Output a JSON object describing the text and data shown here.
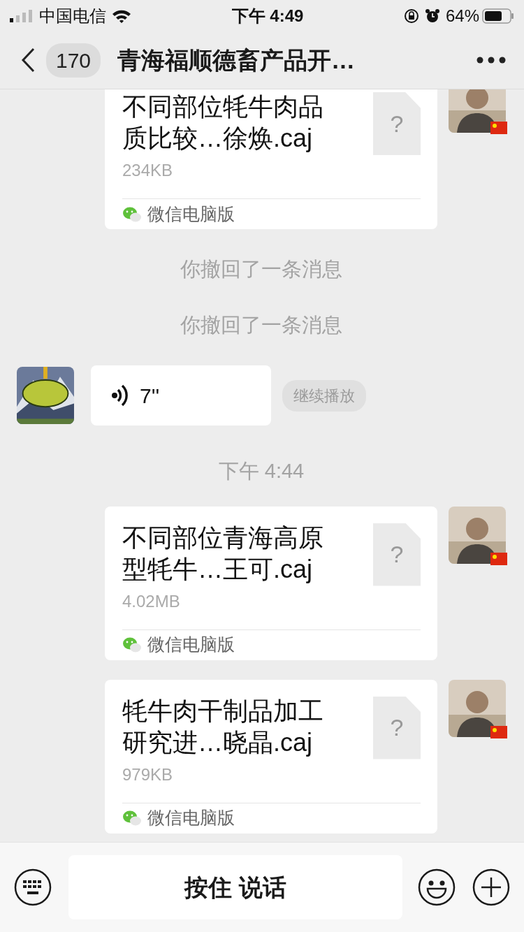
{
  "status_bar": {
    "carrier": "中国电信",
    "time": "下午 4:49",
    "battery": "64%"
  },
  "header": {
    "back_count": "170",
    "title": "青海福顺德畜产品开…"
  },
  "messages": [
    {
      "kind": "file",
      "name": "不同部位牦牛肉品质比较…徐焕.caj",
      "size": "234KB",
      "source": "微信电脑版",
      "icon_mark": "?"
    },
    {
      "kind": "system",
      "text": "你撤回了一条消息"
    },
    {
      "kind": "system",
      "text": "你撤回了一条消息"
    },
    {
      "kind": "voice",
      "duration": "7''",
      "action": "继续播放"
    },
    {
      "kind": "time",
      "text": "下午 4:44"
    },
    {
      "kind": "file",
      "name": "不同部位青海高原型牦牛…王可.caj",
      "size": "4.02MB",
      "source": "微信电脑版",
      "icon_mark": "?"
    },
    {
      "kind": "file",
      "name": "牦牛肉干制品加工研究进…晓晶.caj",
      "size": "979KB",
      "source": "微信电脑版",
      "icon_mark": "?"
    }
  ],
  "input": {
    "voice_button": "按住 说话"
  }
}
